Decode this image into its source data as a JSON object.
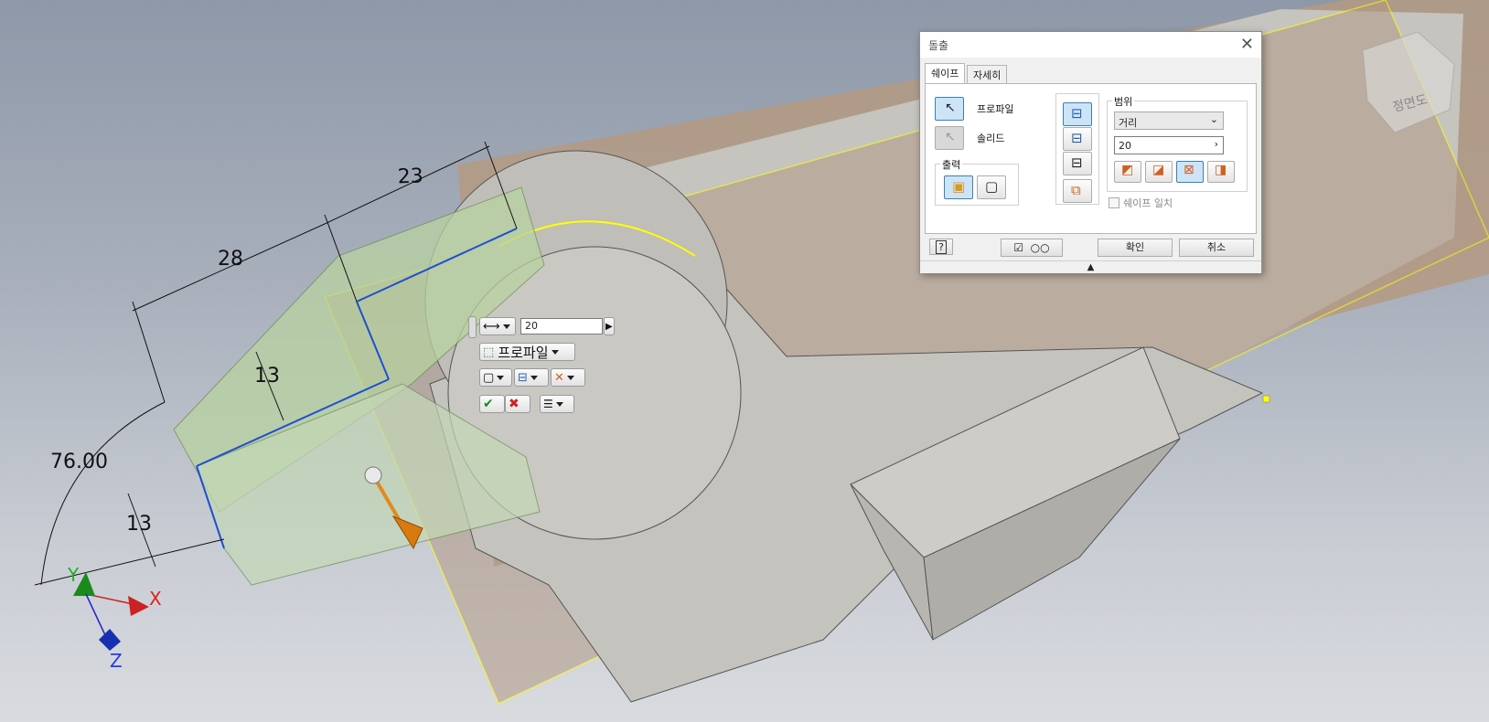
{
  "viewport": {
    "dimensions": [
      {
        "id": "d23",
        "text": "23"
      },
      {
        "id": "d28",
        "text": "28"
      },
      {
        "id": "d13a",
        "text": "13"
      },
      {
        "id": "d13b",
        "text": "13"
      },
      {
        "id": "d76",
        "text": "76.00"
      }
    ],
    "axes": {
      "x": "X",
      "y": "Y",
      "z": "Z"
    },
    "viewcube": {
      "face_label": "정면도"
    }
  },
  "mini_toolbar": {
    "distance_value": "20",
    "profile_label": "프로파일"
  },
  "dialog": {
    "title": "돌출",
    "tabs": [
      {
        "label": "쉐이프"
      },
      {
        "label": "자세히"
      }
    ],
    "profile_label": "프로파일",
    "solid_label": "솔리드",
    "output_group_label": "출력",
    "extents_group_label": "범위",
    "extents_type": "거리",
    "distance_value": "20",
    "match_shape_label": "쉐이프 일치",
    "ok_label": "확인",
    "cancel_label": "취소"
  },
  "colors": {
    "selection": "#ffff00",
    "profile_edge": "#1f4fd0",
    "model_face": "#c4c3bd",
    "preview_fill": "#b8d2a0",
    "gizmo": "#e08a1e"
  }
}
